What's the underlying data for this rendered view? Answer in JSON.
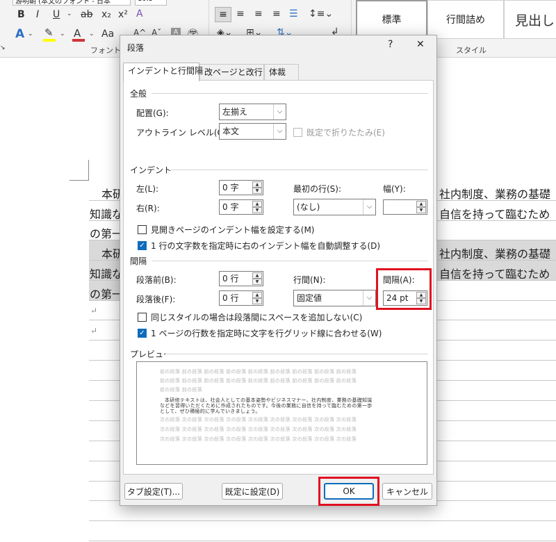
{
  "ribbon": {
    "font_box": "游明朝 (本文のフォント - 日本",
    "size_box": "10.5",
    "font_group_label": "フォント",
    "style_group_label": "スタイル",
    "styles": [
      "標準",
      "行間詰め",
      "見出し"
    ],
    "format_buttons": [
      "B",
      "I",
      "U",
      "ab",
      "x₂",
      "x²",
      "A"
    ],
    "row2_buttons": [
      "A",
      "A",
      "Aa"
    ],
    "colors": {
      "highlight": "#ffff00",
      "font_color": "#d13438",
      "accent": "#0f6cbd"
    }
  },
  "document": {
    "left_lines": [
      "本研",
      "知識な",
      "の第一",
      "本研",
      "知識な",
      "の第一"
    ],
    "right_lines": [
      "社内制度、業務の基礎",
      "自信を持って臨むため",
      "社内制度、業務の基礎",
      "自信を持って臨むため"
    ],
    "paragraph_marks": [
      "↵",
      "↵"
    ]
  },
  "dialog": {
    "title": "段落",
    "help": "?",
    "close": "✕",
    "tabs": [
      "インデントと行間隔",
      "改ページと改行",
      "体裁"
    ],
    "general": {
      "title": "全般",
      "alignment_label": "配置(G):",
      "alignment_value": "左揃え",
      "outline_label": "アウトライン レベル(O):",
      "outline_value": "本文",
      "collapse_label": "既定で折りたたみ(E)"
    },
    "indent": {
      "title": "インデント",
      "left_label": "左(L):",
      "left_value": "0 字",
      "right_label": "右(R):",
      "right_value": "0 字",
      "first_line_label": "最初の行(S):",
      "first_line_value": "(なし)",
      "width_label": "幅(Y):",
      "width_value": "",
      "mirror_label": "見開きページのインデント幅を設定する(M)",
      "auto_adjust_label": "1 行の文字数を指定時に右のインデント幅を自動調整する(D)"
    },
    "spacing": {
      "title": "間隔",
      "before_label": "段落前(B):",
      "before_value": "0 行",
      "after_label": "段落後(F):",
      "after_value": "0 行",
      "line_label": "行間(N):",
      "line_value": "固定値",
      "at_label": "間隔(A):",
      "at_value": "24 pt",
      "no_space_label": "同じスタイルの場合は段落間にスペースを追加しない(C)",
      "snap_grid_label": "1 ページの行数を指定時に文字を行グリッド線に合わせる(W)"
    },
    "preview": {
      "title": "プレビュー",
      "prev_line": "前の段落 前の段落 前の段落 前の段落 前の段落 前の段落 前の段落 前の段落 前の段落",
      "prev_short": "前の段落 前の段落",
      "sample_1": "本研修テキストは、社会人としての基本姿勢やビジネスマナー、社内制度、業務の基礎知識",
      "sample_2": "などを習得いただくために作成されたものです。今後の業務に自信を持って臨むための第一歩",
      "sample_3": "として、ぜひ積極的に学んでいきましょう。",
      "next_line": "次の段落 次の段落 次の段落 次の段落 次の段落 次の段落 次の段落 次の段落 次の段落"
    },
    "buttons": {
      "tabs": "タブ設定(T)...",
      "default": "既定に設定(D)",
      "ok": "OK",
      "cancel": "キャンセル"
    }
  }
}
